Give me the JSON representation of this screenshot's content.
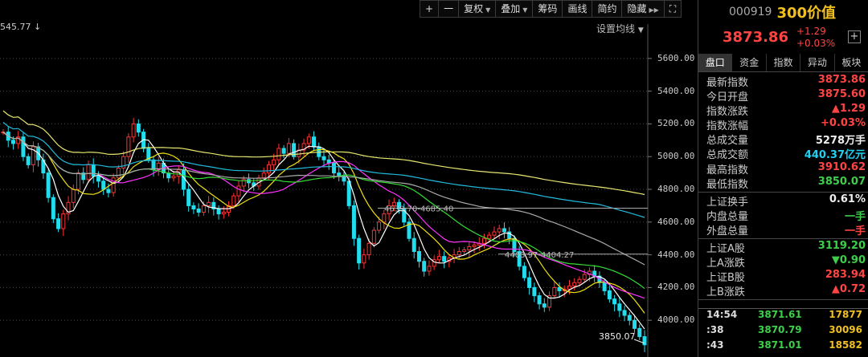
{
  "toolbar": {
    "plus": "+",
    "minus": "一",
    "fuquan": "复权",
    "diejia": "叠加",
    "choumA": "筹码",
    "huaxian": "画线",
    "jianyue": "简约",
    "yincang": "隐藏",
    "expand_icon": "expand-icon"
  },
  "indicator_label": "设置均线",
  "max_label": "545.77",
  "chart_data": {
    "type": "line",
    "title": "",
    "price_axis": [
      5600.0,
      5400.0,
      5200.0,
      5000.0,
      4800.0,
      4600.0,
      4400.0,
      4200.0,
      4000.0
    ],
    "price_axis_labels": [
      "5600.00",
      "5400.00",
      "5200.00",
      "5000.00",
      "4800.00",
      "4600.00",
      "4400.00",
      "4200.00",
      "4000.00"
    ],
    "ylim": [
      3800,
      5810
    ],
    "annotations": [
      {
        "text": "4639.70-4685.40",
        "price": 4685
      },
      {
        "text": "4403.97-4404.27",
        "price": 4404
      }
    ],
    "low_label": "3850.07",
    "low_value": 3850.07,
    "price_series": [
      5150,
      5100,
      5080,
      5120,
      5000,
      4950,
      5060,
      4980,
      4900,
      4750,
      4620,
      4560,
      4650,
      4720,
      4800,
      4900,
      4860,
      4950,
      4880,
      4850,
      4800,
      4780,
      4870,
      4930,
      5000,
      5120,
      5200,
      5150,
      5050,
      4980,
      4920,
      4960,
      4900,
      4870,
      4880,
      4920,
      4800,
      4700,
      4680,
      4660,
      4700,
      4720,
      4680,
      4650,
      4660,
      4700,
      4760,
      4820,
      4860,
      4840,
      4820,
      4870,
      4900,
      4950,
      4980,
      5050,
      5020,
      5080,
      5000,
      5040,
      5080,
      5120,
      5060,
      5000,
      4980,
      4960,
      4900,
      4880,
      4850,
      4700,
      4500,
      4350,
      4400,
      4470,
      4550,
      4600,
      4650,
      4700,
      4720,
      4680,
      4600,
      4500,
      4420,
      4360,
      4300,
      4330,
      4370,
      4390,
      4360,
      4380,
      4400,
      4420,
      4430,
      4450,
      4460,
      4470,
      4500,
      4520,
      4540,
      4560,
      4540,
      4500,
      4420,
      4330,
      4260,
      4200,
      4150,
      4100,
      4080,
      4150,
      4200,
      4180,
      4190,
      4210,
      4230,
      4250,
      4280,
      4300,
      4270,
      4230,
      4180,
      4130,
      4100,
      4060,
      4030,
      4000,
      3950,
      3900,
      3850
    ],
    "ma_colors": [
      "#ffffff",
      "#f0e010",
      "#ff33ff",
      "#33dd33",
      "#aaaaaa",
      "#22bbdd",
      "#e8e870"
    ],
    "ma_periods": [
      5,
      10,
      20,
      30,
      60,
      120,
      250
    ]
  },
  "side": {
    "code": "000919",
    "name": "300价值",
    "price": "3873.86",
    "chg": "+1.29",
    "pct": "+0.03%",
    "add_label": "+",
    "tabs": [
      "盘口",
      "资金",
      "指数",
      "异动",
      "板块"
    ],
    "rows": [
      {
        "l": "最新指数",
        "v": "3873.86",
        "c": "red"
      },
      {
        "l": "今日开盘",
        "v": "3875.60",
        "c": "red"
      },
      {
        "l": "指数涨跌",
        "v": "▲1.29",
        "c": "red"
      },
      {
        "l": "指数涨幅",
        "v": "+0.03%",
        "c": "red"
      },
      {
        "l": "总成交量",
        "v": "5278万手",
        "c": "white"
      },
      {
        "l": "总成交额",
        "v": "440.37亿元",
        "c": "cyan"
      },
      {
        "l": "最高指数",
        "v": "3910.62",
        "c": "red"
      },
      {
        "l": "最低指数",
        "v": "3850.07",
        "c": "green"
      }
    ],
    "rows2": [
      {
        "l": "上证换手",
        "v": "0.61%",
        "c": "white"
      },
      {
        "l": "内盘总量",
        "v": "一手",
        "c": "green"
      },
      {
        "l": "外盘总量",
        "v": "一手",
        "c": "red"
      }
    ],
    "rows3": [
      {
        "l": "上证A股",
        "v": "3119.20",
        "c": "green"
      },
      {
        "l": "上A涨跌",
        "v": "▼0.90",
        "c": "green"
      },
      {
        "l": "上证B股",
        "v": "283.94",
        "c": "red"
      },
      {
        "l": "上B涨跌",
        "v": "▲0.72",
        "c": "red"
      }
    ],
    "ticks": [
      {
        "t": "14:54",
        "p": "3871.61",
        "v": "17877"
      },
      {
        "t": ":38",
        "p": "3870.79",
        "v": "30096"
      },
      {
        "t": ":43",
        "p": "3871.01",
        "v": "18582"
      }
    ]
  }
}
